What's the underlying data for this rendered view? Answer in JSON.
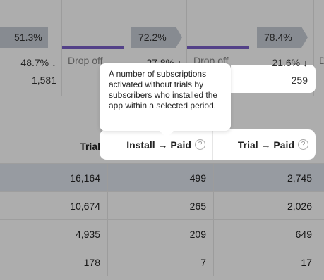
{
  "funnel": {
    "steps": [
      {
        "pct": "51.3%"
      },
      {
        "pct": "72.2%",
        "arrow_value": "48.7% ↓",
        "count": "1,581",
        "drop_label": "Drop off"
      },
      {
        "pct": "78.4%",
        "arrow_value": "27.8% ↓",
        "drop_label": "Drop off"
      },
      {
        "arrow_value": "21.6% ↓",
        "count": "259",
        "drop_label": "D"
      }
    ],
    "accent": "#7b61c9"
  },
  "tooltip": {
    "text": "A number of subscriptions activated without trials by subscribers who installed the app within a selected period."
  },
  "table": {
    "headers": {
      "trial_partial": "Trial",
      "install_paid": "Install → Paid",
      "trial_paid": "Trial → Paid",
      "help_glyph": "?"
    },
    "rows": [
      [
        "16,164",
        "499",
        "2,745"
      ],
      [
        "10,674",
        "265",
        "2,026"
      ],
      [
        "4,935",
        "209",
        "649"
      ],
      [
        "178",
        "7",
        "17"
      ]
    ]
  }
}
